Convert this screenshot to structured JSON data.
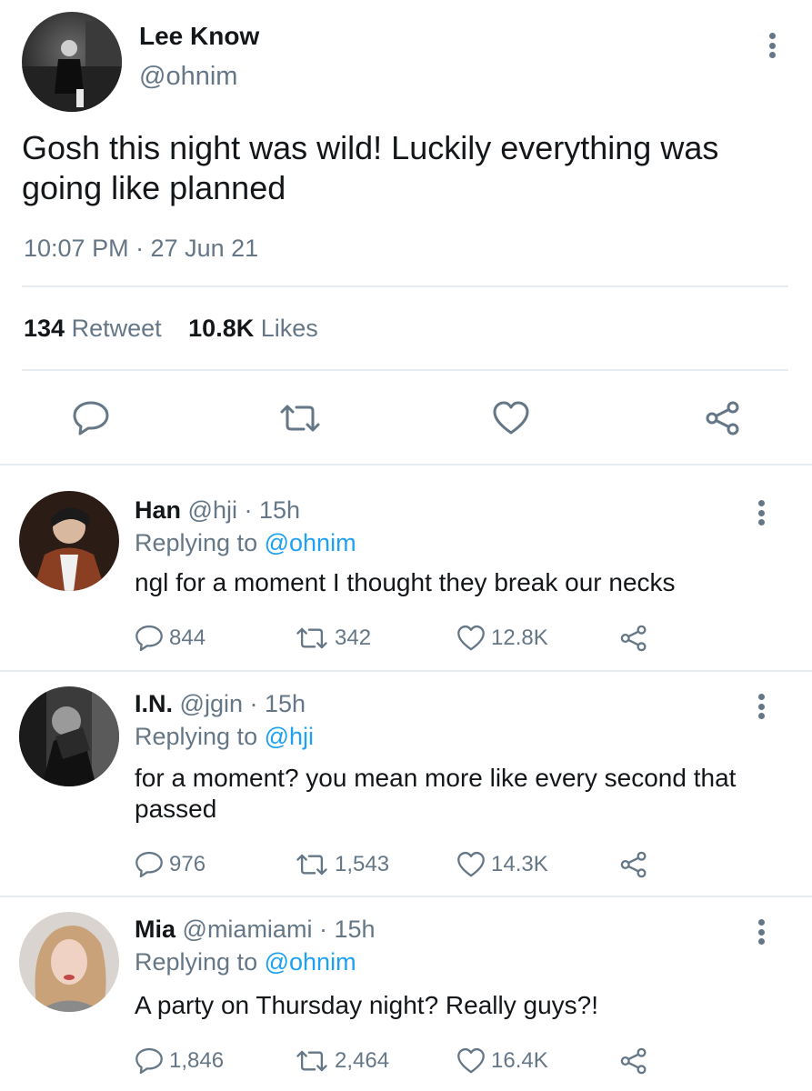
{
  "main_tweet": {
    "name": "Lee Know",
    "handle": "@ohnim",
    "text": "Gosh this night was wild! Luckily everything was going like planned",
    "time": "10:07 PM · 27 Jun 21",
    "retweet_count": "134",
    "retweet_label": "Retweet",
    "like_count": "10.8K",
    "like_label": "Likes"
  },
  "replies": [
    {
      "name": "Han",
      "handle": "@hji",
      "sep": "·",
      "age": "15h",
      "replying_label": "Replying to",
      "replying_to": "@ohnim",
      "text": "ngl for a moment I thought they break our necks",
      "replies": "844",
      "retweets": "342",
      "likes": "12.8K"
    },
    {
      "name": "I.N.",
      "handle": "@jgin",
      "sep": "·",
      "age": "15h",
      "replying_label": "Replying to",
      "replying_to": "@hji",
      "text": "for a moment? you mean more like every second that passed",
      "replies": "976",
      "retweets": "1,543",
      "likes": "14.3K"
    },
    {
      "name": "Mia",
      "handle": "@miamiami",
      "sep": "·",
      "age": "15h",
      "replying_label": "Replying to",
      "replying_to": "@ohnim",
      "text": "A party on Thursday night? Really guys?!",
      "replies": "1,846",
      "retweets": "2,464",
      "likes": "16.4K"
    }
  ],
  "colors": {
    "text": "#14171a",
    "secondary": "#657786",
    "link": "#1da1f2",
    "divider": "#e6ecf0"
  },
  "icons": [
    "reply-icon",
    "retweet-icon",
    "like-icon",
    "share-icon",
    "more-icon"
  ]
}
